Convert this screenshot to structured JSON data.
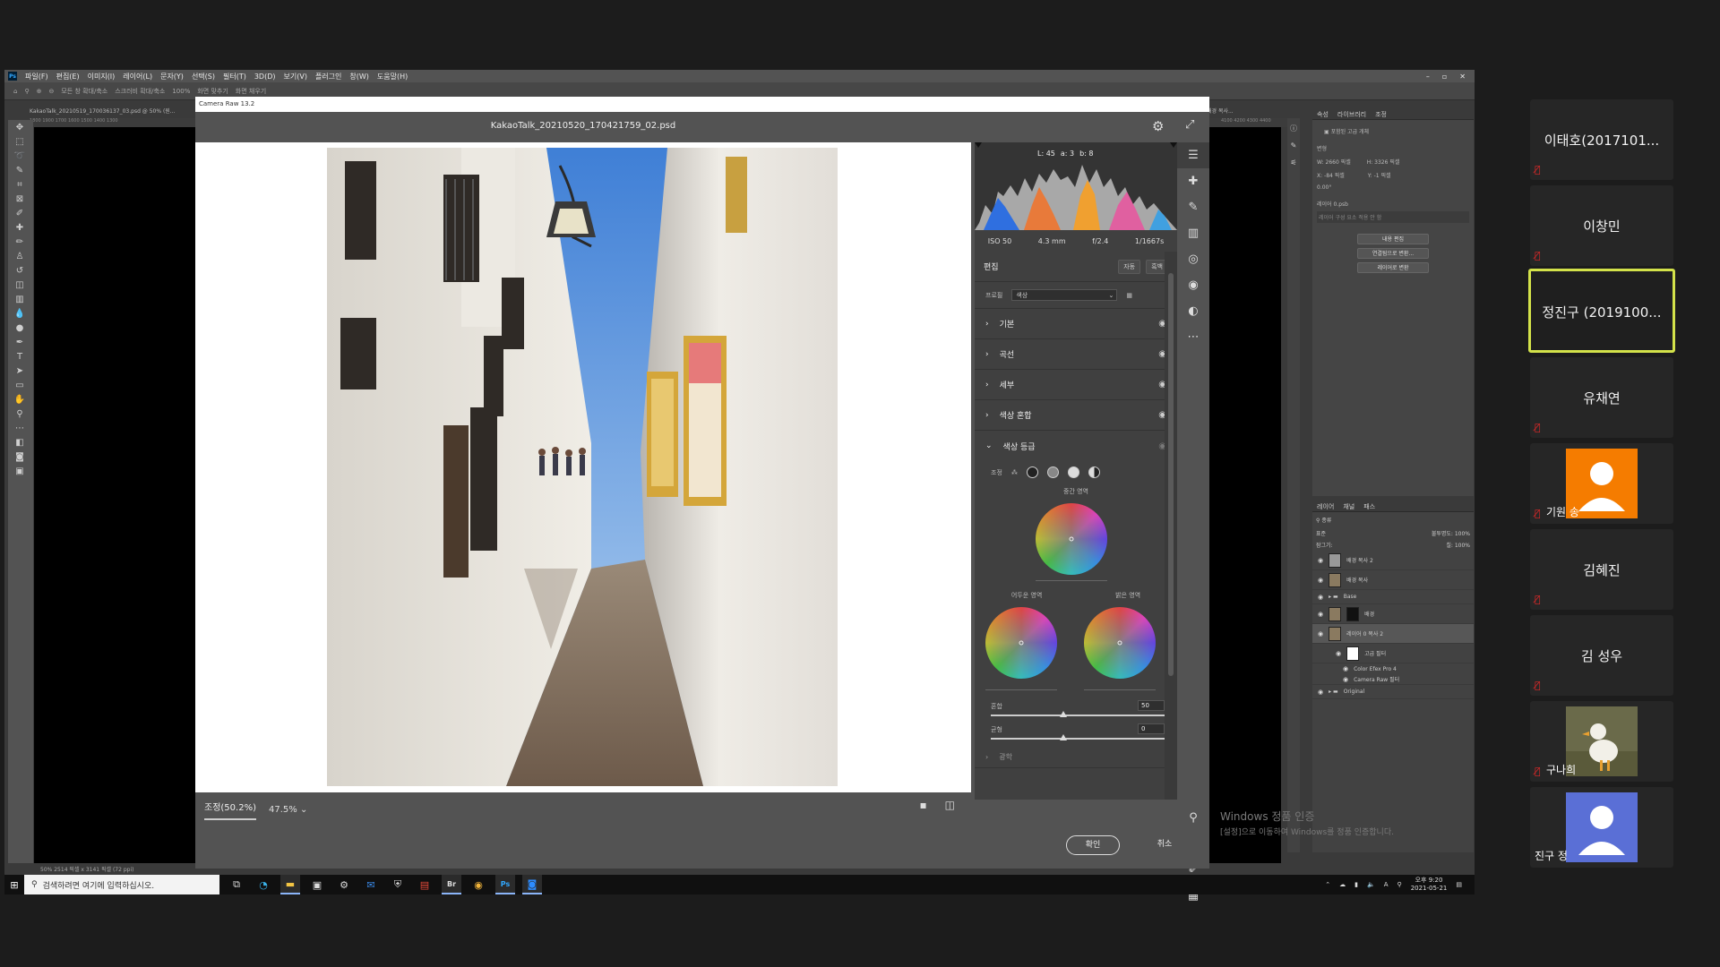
{
  "photoshop": {
    "menu": [
      "파일(F)",
      "편집(E)",
      "이미지(I)",
      "레이어(L)",
      "문자(Y)",
      "선택(S)",
      "필터(T)",
      "3D(D)",
      "보기(V)",
      "플러그인",
      "창(W)",
      "도움말(H)"
    ],
    "options_bar": [
      "모든 창 확대/축소",
      "스크러비 확대/축소",
      "100%",
      "화면 맞추기",
      "화면 채우기"
    ],
    "doc_tab": "KakaoTalk_20210519_170036137_03.psd @ 50% (원...",
    "doc_tab_right": "배경 복사...",
    "ruler": "1800  1900  1700  1600  1500  1400  1300",
    "ruler_right": "4100  4200  4300  4400",
    "status": "50%      2514 픽셀 x 3141 픽셀 (72 ppi)",
    "properties": {
      "tabs": [
        "속성",
        "라이브러리",
        "조정"
      ],
      "type_label": "포함된 고급 개체",
      "section": "변형",
      "w": "W: 2660 픽셀",
      "h": "H: 3326 픽셀",
      "x": "X: -84 픽셀",
      "y": "Y: -1 픽셀",
      "angle": "0.00°",
      "file": "레이어 0.psb",
      "comps": "레이어 구성 요소 적용 안 함",
      "buttons": [
        "내용 편집",
        "연결됨으로 변환...",
        "레이어로 변환"
      ]
    },
    "layers": {
      "tabs": [
        "레이어",
        "채널",
        "패스"
      ],
      "filter": "종류",
      "blend": "표준",
      "opacity": "불투명도: 100%",
      "lock": "잠그기:",
      "fill": "칠: 100%",
      "rows": [
        "배경 복사 2",
        "배경 복사",
        "Base",
        "배경",
        "레이어 0 복사 2",
        "고급 필터",
        "Color Efex Pro 4",
        "Camera Raw 필터",
        "Original"
      ]
    }
  },
  "camera_raw": {
    "window_title": "Camera Raw 13.2",
    "filename": "KakaoTalk_20210520_170421759_02.psd",
    "histogram_readout": {
      "l": "L: 45",
      "a": "a: 3",
      "b": "b: 8"
    },
    "exif": [
      "ISO 50",
      "4.3 mm",
      "f/2.4",
      "1/1667s"
    ],
    "edit_title": "편집",
    "auto_label": "자동",
    "bw_label": "흑백",
    "profile_label": "프로필",
    "profile_value": "색상",
    "sections": [
      "기본",
      "곡선",
      "세부",
      "색상 혼합",
      "색상 등급"
    ],
    "grading": {
      "adjust_label": "조정",
      "midtones": "중간 영역",
      "shadows": "어두운 영역",
      "highlights": "밝은 영역",
      "blending_label": "혼합",
      "blending_value": "50",
      "balance_label": "균형",
      "balance_value": "0"
    },
    "next_section": "광학",
    "zoom_fit": "조정(50.2%)",
    "zoom_value": "47.5%",
    "ok": "확인",
    "cancel": "취소"
  },
  "taskbar": {
    "search_placeholder": "검색하려면 여기에 입력하십시오.",
    "time": "오후 9:20",
    "date": "2021-05-21"
  },
  "watermark": {
    "title": "Windows 정품 인증",
    "subtitle": "[설정]으로 이동하여 Windows를 정품 인증합니다."
  },
  "zoom_participants": [
    {
      "name": "이태호(2017101...",
      "muted": true
    },
    {
      "name": "이창민",
      "muted": true
    },
    {
      "name": "정진구 (2019100...",
      "muted": false,
      "speaking": true
    },
    {
      "name": "유채연",
      "muted": true
    },
    {
      "name": "기원 송",
      "muted": true,
      "avatar": "default-avatar",
      "color": "#f57c00"
    },
    {
      "name": "김혜진",
      "muted": true
    },
    {
      "name": "김 성우",
      "muted": true
    },
    {
      "name": "구나희",
      "muted": true,
      "avatar": "duck-photo"
    },
    {
      "name": "진구 정",
      "muted": false,
      "avatar": "default-avatar",
      "color": "#5a6fd6"
    }
  ]
}
